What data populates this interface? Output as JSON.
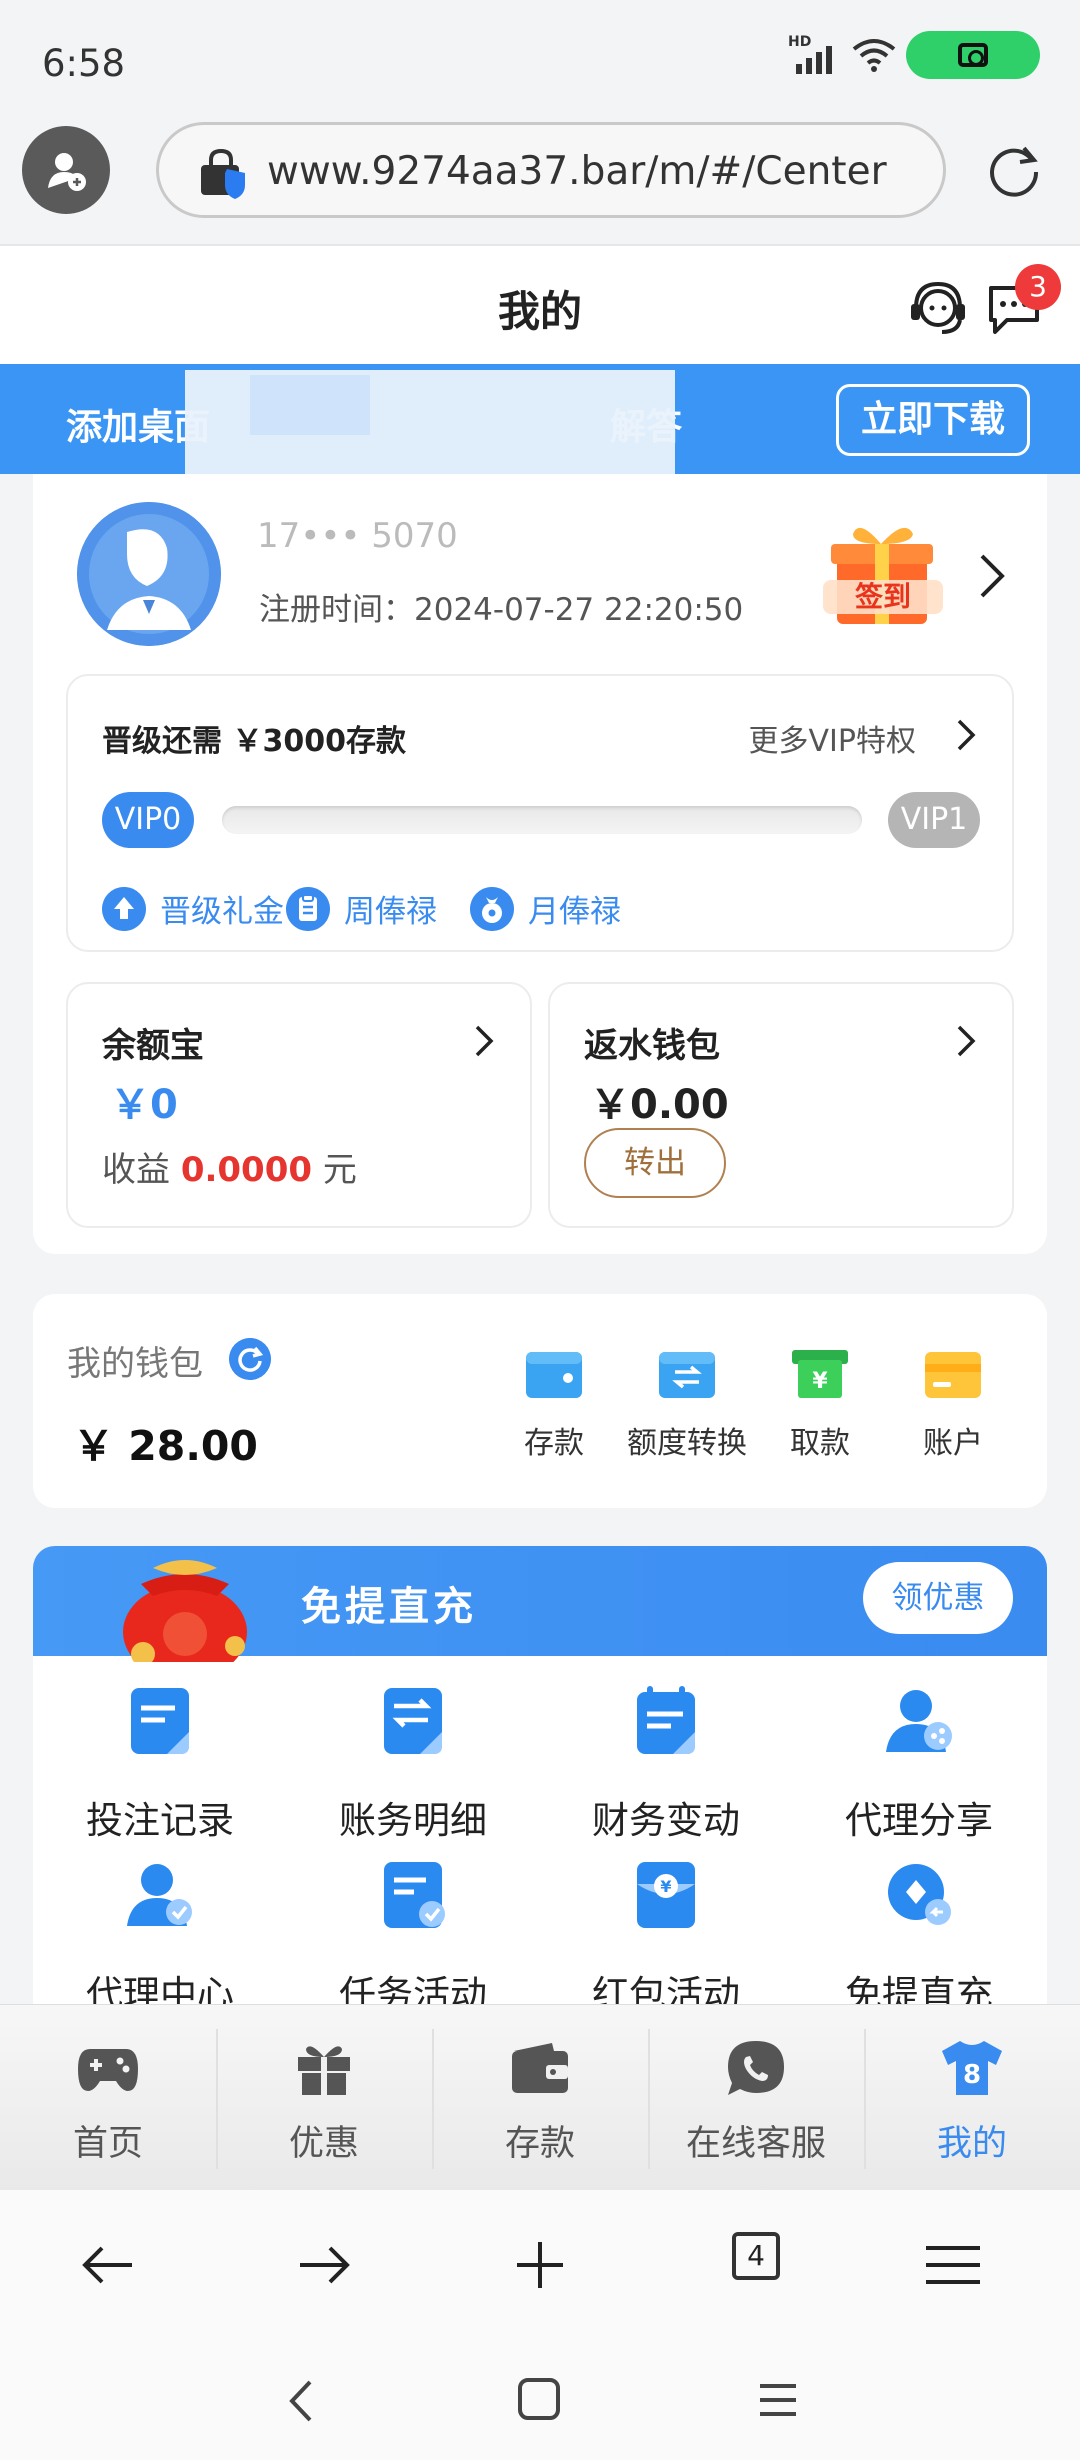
{
  "status_bar": {
    "time": "6:58",
    "network": "HD"
  },
  "browser": {
    "url": "www.9274aa37.bar/m/#/Center",
    "tab_count": "4"
  },
  "header": {
    "title": "我的",
    "message_badge": "3"
  },
  "download_banner": {
    "text_left": "添加桌面",
    "text_right": "解答",
    "button": "立即下载"
  },
  "user": {
    "username": "17••• 5070",
    "register_time": "注册时间：2024-07-27 22:20:50"
  },
  "vip": {
    "need_text": "晋级还需 ￥3000存款",
    "more_text": "更多VIP特权",
    "current_level": "VIP0",
    "next_level": "VIP1",
    "progress": 0,
    "perks": [
      "晋级礼金",
      "周俸禄",
      "月俸禄"
    ]
  },
  "balance_card": {
    "title": "余额宝",
    "amount": "￥0",
    "income_label": "收益",
    "income_value": "0.0000",
    "income_unit": "元"
  },
  "rebate_card": {
    "title": "返水钱包",
    "amount": "￥0.00",
    "transfer_button": "转出"
  },
  "wallet": {
    "label": "我的钱包",
    "amount": "￥ 28.00",
    "actions": [
      "存款",
      "额度转换",
      "取款",
      "账户"
    ]
  },
  "feature_section": {
    "banner_title": "免提直充",
    "banner_button": "领优惠",
    "items": [
      "投注记录",
      "账务明细",
      "财务变动",
      "代理分享",
      "代理中心",
      "任务活动",
      "红包活动",
      "免提直充"
    ]
  },
  "app_nav": {
    "items": [
      "首页",
      "优惠",
      "存款",
      "在线客服",
      "我的"
    ],
    "active": "我的"
  },
  "colors": {
    "primary": "#3a8bf0",
    "red": "#e6342e",
    "green": "#2fcf6a"
  }
}
